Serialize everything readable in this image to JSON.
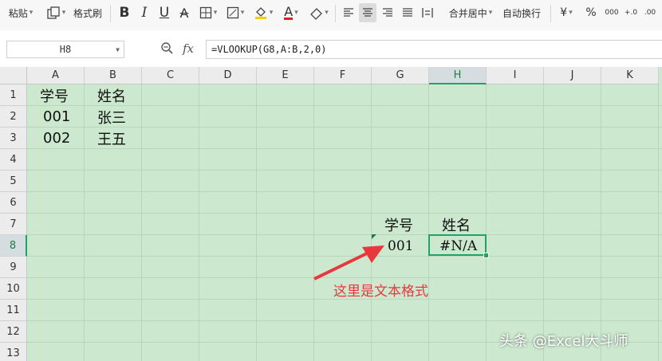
{
  "toolbar": {
    "paste": "粘贴",
    "format_painter": "格式刷",
    "bold": "B",
    "italic": "I",
    "underline": "U",
    "strike": "A",
    "font_color": "A",
    "merge_center": "合并居中",
    "wrap_text": "自动换行",
    "currency": "¥",
    "percent": "%",
    "thousands": "000",
    "increase_decimal": "+.0",
    "decrease_decimal": ".00"
  },
  "formula_bar": {
    "name_box": "H8",
    "fx_label": "fx",
    "formula": "=VLOOKUP(G8,A:B,2,0)"
  },
  "grid": {
    "columns": [
      "A",
      "B",
      "C",
      "D",
      "E",
      "F",
      "G",
      "H",
      "I",
      "J",
      "K"
    ],
    "rows": [
      "1",
      "2",
      "3",
      "4",
      "5",
      "6",
      "7",
      "8",
      "9",
      "10",
      "11",
      "12",
      "13"
    ],
    "active_column": "H",
    "active_row": "8"
  },
  "cells": {
    "A1": "学号",
    "B1": "姓名",
    "A2": "001",
    "B2": "张三",
    "A3": "002",
    "B3": "王五",
    "G7": "学号",
    "H7": "姓名",
    "G8": "001",
    "H8": "#N/A"
  },
  "annotation": {
    "text": "这里是文本格式",
    "color": "#e8383d"
  },
  "watermark": "头条 @Excel大斗师",
  "colors": {
    "sheet_background": "#cce8cf",
    "selection": "#21a366",
    "arrow": "#e8383d"
  }
}
